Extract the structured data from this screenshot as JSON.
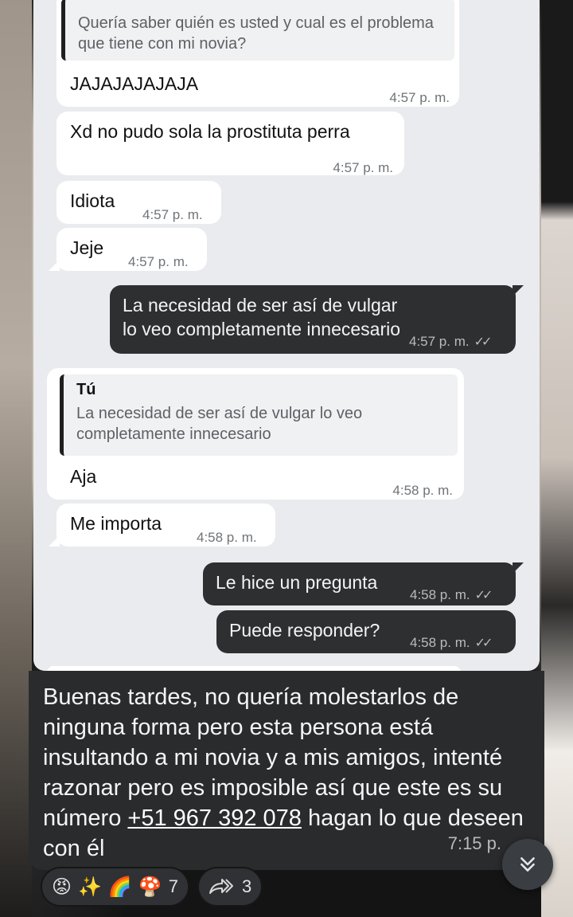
{
  "screenshot": {
    "msg1": {
      "quote_text": "Quería saber quién es usted y cual es el problema que tiene con mi novia?",
      "text": "JAJAJAJAJAJA",
      "time": "4:57 p. m."
    },
    "msg2": {
      "text": "Xd no pudo sola la prostituta perra",
      "time": "4:57 p. m."
    },
    "msg3": {
      "text": "Idiota",
      "time": "4:57 p. m."
    },
    "msg4": {
      "text": "Jeje",
      "time": "4:57 p. m."
    },
    "msg5": {
      "text": "La necesidad de ser así de vulgar lo veo completamente innecesario",
      "time": "4:57 p. m."
    },
    "msg6": {
      "quote_name": "Tú",
      "quote_text": "La necesidad de ser así de vulgar lo veo completamente innecesario",
      "text": "Aja",
      "time": "4:58 p. m."
    },
    "msg7": {
      "text": "Me importa",
      "time": "4:58 p. m."
    },
    "msg8": {
      "text": "Le hice un pregunta",
      "time": "4:58 p. m."
    },
    "msg9": {
      "text": "Puede responder?",
      "time": "4:58 p. m."
    }
  },
  "caption": {
    "text_before": "Buenas tardes, no quería molestarlos de ninguna forma pero esta persona está insultando a mi novia y a mis amigos, intenté razonar pero es imposible así que este es su número ",
    "phone": "+51 967 392 078",
    "text_after": " hagan lo que deseen con él",
    "time": "7:15 p."
  },
  "reactions": {
    "emojis": [
      "😡",
      "✨",
      "🌈",
      "🍄"
    ],
    "count": "7",
    "shares": "3"
  },
  "icons": {
    "read_ticks": "double-check-icon",
    "scroll_down": "chevrons-down-icon",
    "share": "forward-icon"
  }
}
